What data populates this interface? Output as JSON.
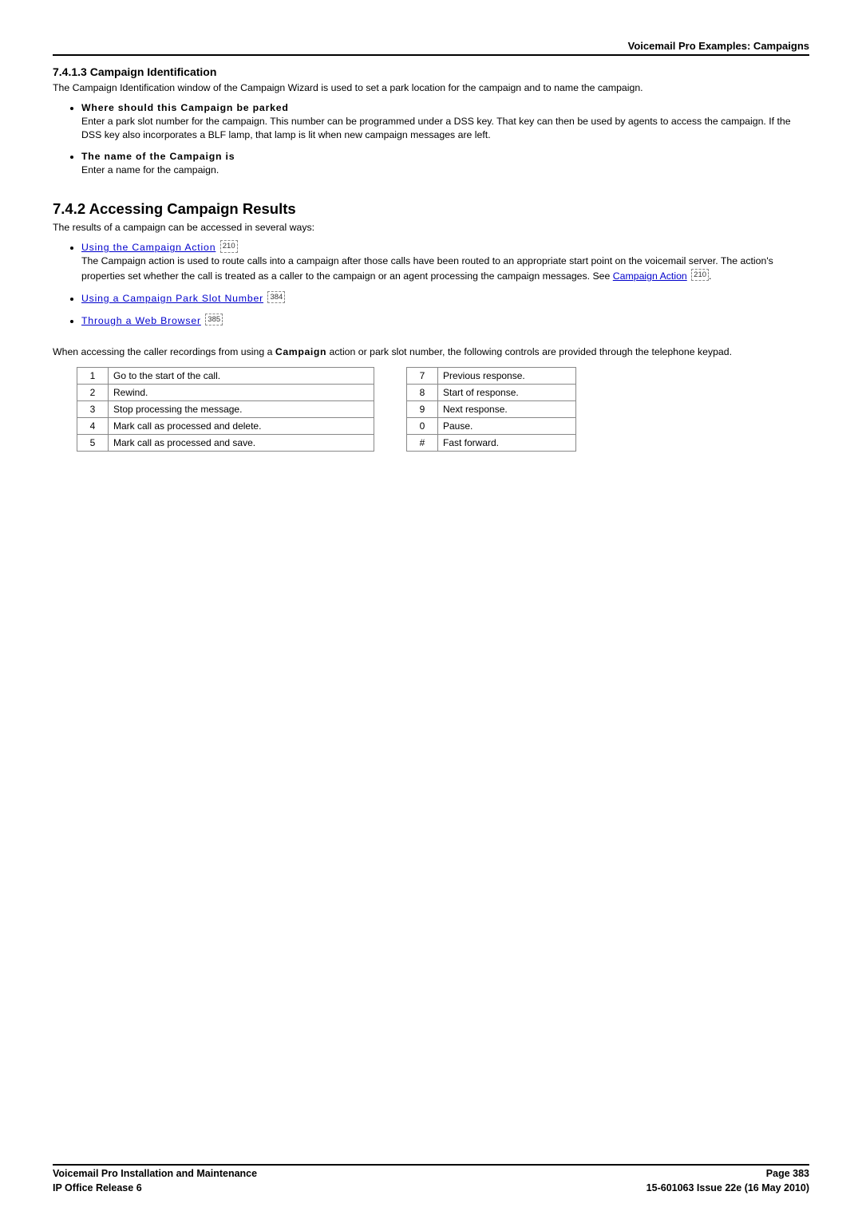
{
  "header": {
    "breadcrumb": "Voicemail Pro Examples: Campaigns"
  },
  "section_7_4_1_3": {
    "title": "7.4.1.3 Campaign Identification",
    "intro": "The Campaign Identification window of the Campaign Wizard is used to set a park location for the campaign and to name the campaign.",
    "items": [
      {
        "lead": "Where should this Campaign be parked",
        "body": "Enter a park slot number for the campaign. This number can be programmed under a DSS key. That key can then be used by agents to access the campaign. If the DSS key also incorporates a BLF lamp, that lamp is lit when new campaign messages are left."
      },
      {
        "lead": "The name of the Campaign is",
        "body": "Enter a name for the campaign."
      }
    ]
  },
  "section_7_4_2": {
    "title": "7.4.2 Accessing Campaign Results",
    "intro": "The results of a campaign can be accessed in several ways:",
    "items": [
      {
        "link": "Using the Campaign Action",
        "ref": "210",
        "body_pre": "The Campaign action is used to route calls into a campaign after those calls have been routed to an appropriate start point on the voicemail server. The action's properties set whether the call is treated as a caller to the campaign or an agent processing the campaign messages. See ",
        "body_link": "Campaign Action",
        "body_ref": "210",
        "body_post": "."
      },
      {
        "link": "Using a Campaign Park Slot Number",
        "ref": "384"
      },
      {
        "link": "Through a Web Browser",
        "ref": "385"
      }
    ],
    "access_note_pre": "When accessing the caller recordings from using a ",
    "access_note_bold": "Campaign",
    "access_note_post": " action or park slot number, the following controls are provided through the telephone keypad."
  },
  "keypad": {
    "rows": [
      {
        "n1": "1",
        "d1": "Go to the start of the call.",
        "n2": "7",
        "d2": "Previous response."
      },
      {
        "n1": "2",
        "d1": "Rewind.",
        "n2": "8",
        "d2": "Start of response."
      },
      {
        "n1": "3",
        "d1": "Stop processing the message.",
        "n2": "9",
        "d2": "Next response."
      },
      {
        "n1": "4",
        "d1": "Mark call as processed and delete.",
        "n2": "0",
        "d2": "Pause."
      },
      {
        "n1": "5",
        "d1": "Mark call as processed and save.",
        "n2": "#",
        "d2": "Fast forward."
      }
    ]
  },
  "footer": {
    "left1": "Voicemail Pro Installation and Maintenance",
    "left2": "IP Office Release 6",
    "right1": "Page 383",
    "right2": "15-601063 Issue 22e (16 May 2010)"
  }
}
